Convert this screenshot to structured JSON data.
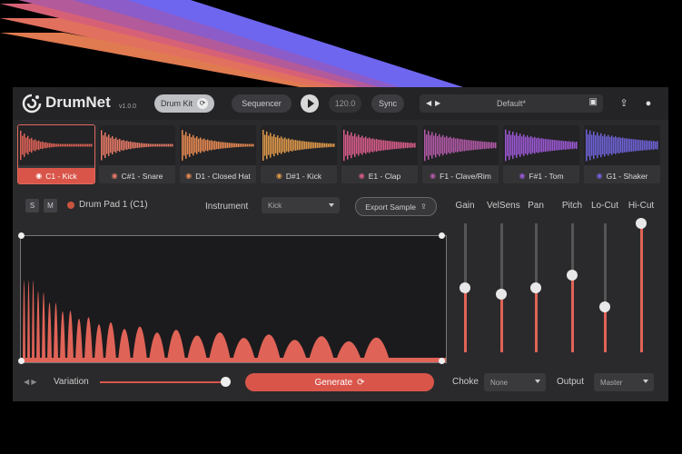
{
  "header": {
    "brand": "DrumNet",
    "version": "v1.0.0",
    "drum_kit_label": "Drum Kit",
    "sequencer_label": "Sequencer",
    "tempo": "120.0",
    "sync_label": "Sync",
    "preset_name": "Default*"
  },
  "pads": [
    {
      "label": "C1 - Kick",
      "color": "#e06357",
      "icon": "kick-icon",
      "selected": true
    },
    {
      "label": "C#1 - Snare",
      "color": "#e77a66",
      "icon": "snare-icon"
    },
    {
      "label": "D1 - Closed Hat",
      "color": "#e88a52",
      "icon": "hat-icon"
    },
    {
      "label": "D#1 - Kick",
      "color": "#e09a4a",
      "icon": "kick-icon"
    },
    {
      "label": "E1 - Clap",
      "color": "#d85c8a",
      "icon": "clap-icon"
    },
    {
      "label": "F1 - Clave/Rim",
      "color": "#b35aa8",
      "icon": "clave-icon"
    },
    {
      "label": "F#1 - Tom",
      "color": "#9b58d4",
      "icon": "tom-icon"
    },
    {
      "label": "G1 - Shaker",
      "color": "#6f63d8",
      "icon": "shaker-icon"
    }
  ],
  "editor": {
    "solo": "S",
    "mute": "M",
    "pad_name": "Drum Pad 1 (C1)",
    "instrument_label": "Instrument",
    "instrument_value": "Kick",
    "export_label": "Export Sample"
  },
  "mixer": [
    {
      "label": "Gain",
      "level": 0.5
    },
    {
      "label": "VelSens",
      "level": 0.45
    },
    {
      "label": "Pan",
      "level": 0.5
    },
    {
      "label": "Pitch",
      "level": 0.6
    },
    {
      "label": "Lo-Cut",
      "level": 0.35
    },
    {
      "label": "Hi-Cut",
      "level": 1.0
    }
  ],
  "bottom": {
    "variation_label": "Variation",
    "variation_level": 0.95,
    "generate_label": "Generate",
    "choke_label": "Choke",
    "choke_value": "None",
    "output_label": "Output",
    "output_value": "Master"
  },
  "colors": {
    "accent": "#d9554a",
    "stripes": [
      "#e07a50",
      "#e2705f",
      "#d66177",
      "#b35a9a",
      "#8c5cc8",
      "#6f66f0"
    ]
  }
}
